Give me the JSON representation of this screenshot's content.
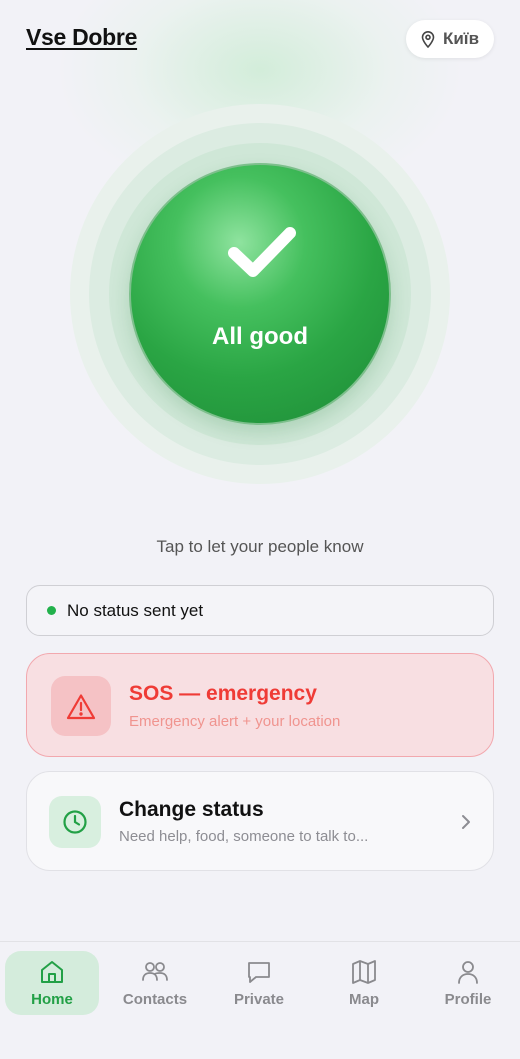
{
  "header": {
    "app_title": "Vse Dobre",
    "location": "Київ",
    "location_icon": "location-pin-icon"
  },
  "status_button": {
    "label": "All good",
    "icon": "checkmark-icon"
  },
  "hint": "Tap to let your people know",
  "last_status": {
    "text": "No status sent yet",
    "dot_color": "#22b14c"
  },
  "sos_card": {
    "title": "SOS — emergency",
    "subtitle": "Emergency alert + your location",
    "icon": "warning-triangle-icon",
    "accent_color": "#ef3b36"
  },
  "change_status_card": {
    "title": "Change status",
    "subtitle": "Need help, food, someone to talk to...",
    "icon": "clock-icon"
  },
  "tabbar": {
    "active": "Home",
    "tabs": [
      {
        "label": "Home",
        "icon": "home-icon"
      },
      {
        "label": "Contacts",
        "icon": "people-icon"
      },
      {
        "label": "Private",
        "icon": "chat-bubble-icon"
      },
      {
        "label": "Map",
        "icon": "map-icon"
      },
      {
        "label": "Profile",
        "icon": "person-icon"
      }
    ]
  },
  "colors": {
    "accent_green": "#22a046",
    "background": "#f2f2f7"
  }
}
